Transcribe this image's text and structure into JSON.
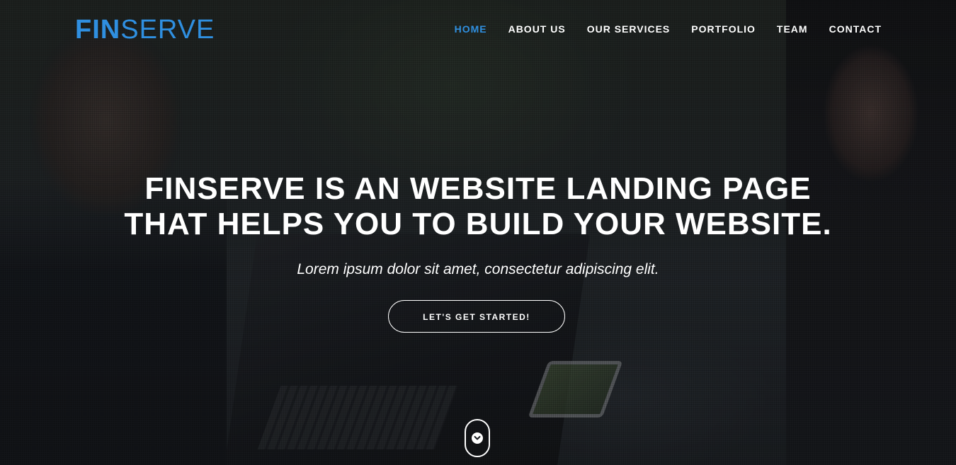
{
  "brand": {
    "logo_bold": "FIN",
    "logo_light": "SERVE",
    "accent_color": "#2f8fe0"
  },
  "nav": {
    "items": [
      {
        "label": "HOME",
        "active": true
      },
      {
        "label": "ABOUT US",
        "active": false
      },
      {
        "label": "OUR SERVICES",
        "active": false
      },
      {
        "label": "PORTFOLIO",
        "active": false
      },
      {
        "label": "TEAM",
        "active": false
      },
      {
        "label": "CONTACT",
        "active": false
      }
    ]
  },
  "hero": {
    "headline_line1": "FINSERVE IS AN WEBSITE LANDING PAGE",
    "headline_line2": "THAT HELPS YOU TO BUILD YOUR WEBSITE.",
    "subtitle": "Lorem ipsum dolor sit amet, consectetur adipiscing elit.",
    "cta_label": "LET'S GET STARTED!",
    "scroll_icon": "chevron-down-icon"
  }
}
